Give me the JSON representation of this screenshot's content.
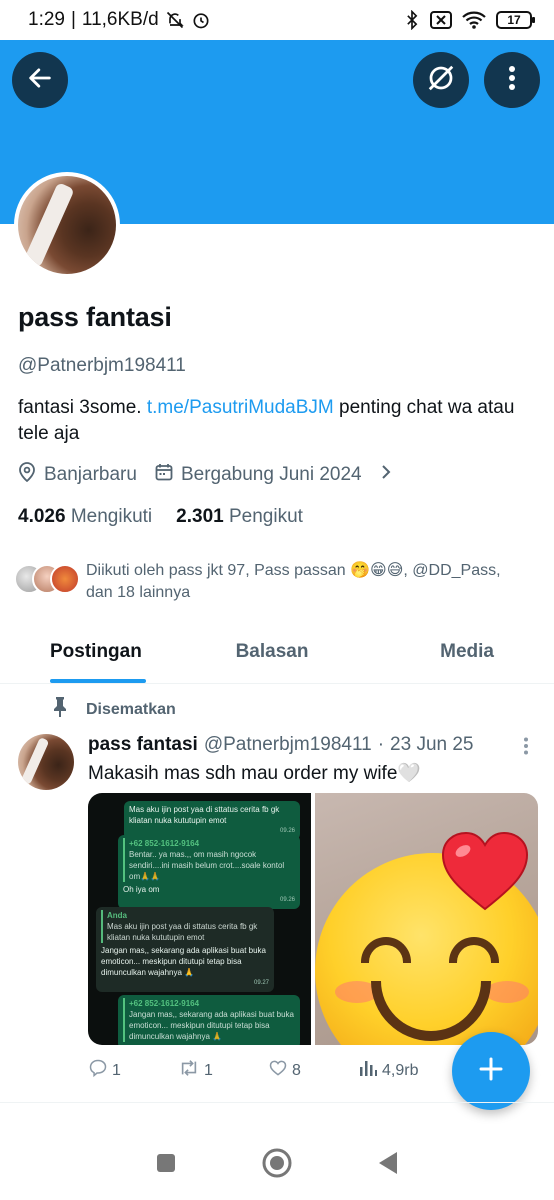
{
  "status_bar": {
    "time": "1:29",
    "separator": "|",
    "speed": "11,6KB/d",
    "battery": "17"
  },
  "profile": {
    "name": "pass fantasi",
    "handle": "@Patnerbjm198411",
    "bio_prefix": "fantasi 3some.",
    "bio_link": "t.me/PasutriMudaBJM",
    "bio_suffix": "penting chat wa atau tele aja",
    "location": "Banjarbaru",
    "joined": "Bergabung Juni 2024",
    "following_count": "4.026",
    "following_label": "Mengikuti",
    "followers_count": "2.301",
    "followers_label": "Pengikut",
    "followed_by": "Diikuti oleh pass jkt 97, Pass passan 🤭😁😅, @DD_Pass, dan 18 lainnya"
  },
  "tabs": [
    {
      "label": "Postingan",
      "active": true
    },
    {
      "label": "Balasan",
      "active": false
    },
    {
      "label": "Media",
      "active": false
    }
  ],
  "post": {
    "pinned_label": "Disematkan",
    "name": "pass fantasi",
    "handle": "@Patnerbjm198411",
    "dot": "·",
    "date": "23 Jun 25",
    "text": "Makasih mas sdh mau order my wife🤍",
    "replies": "1",
    "reposts": "1",
    "likes": "8",
    "views": "4,9rb",
    "chat": {
      "msg1": "Mas aku ijin post yaa di sttatus cerita fb gk kliatan nuka kututupin emot",
      "msg1_time": "09.26",
      "msg2_quote_name": "+62 852-1612-9164",
      "msg2_quote": "Bentar.. ya mas.,, om masih ngocok sendiri....ini masih belum crot....soale kontol om🙏🙏",
      "msg2_text": "Oh iya om",
      "msg2_time": "09.26",
      "msg3_quote_name": "Anda",
      "msg3_quote": "Mas aku ijin post yaa di sttatus cerita fb gk kliatan nuka kututupin emot",
      "msg3_text": "Jangan mas,, sekarang ada aplikasi buat buka emoticon... meskipun ditutupi tetap bisa dimunculkan wajahnya 🙏",
      "msg3_time": "09.27",
      "msg4_quote_name": "+62 852-1612-9164",
      "msg4_quote": "Jangan mas,, sekarang ada aplikasi buat buka emoticon... meskipun ditutupi tetap bisa dimunculkan wajahnya 🙏"
    }
  },
  "colors": {
    "accent": "#1d9bf0",
    "text": "#0f1419",
    "muted": "#536471"
  },
  "icons": [
    "back-arrow-icon",
    "grok-icon",
    "more-vertical-icon",
    "location-icon",
    "calendar-icon",
    "chevron-right-icon",
    "pin-icon",
    "reply-icon",
    "repost-icon",
    "like-icon",
    "views-icon",
    "compose-plus-icon"
  ]
}
